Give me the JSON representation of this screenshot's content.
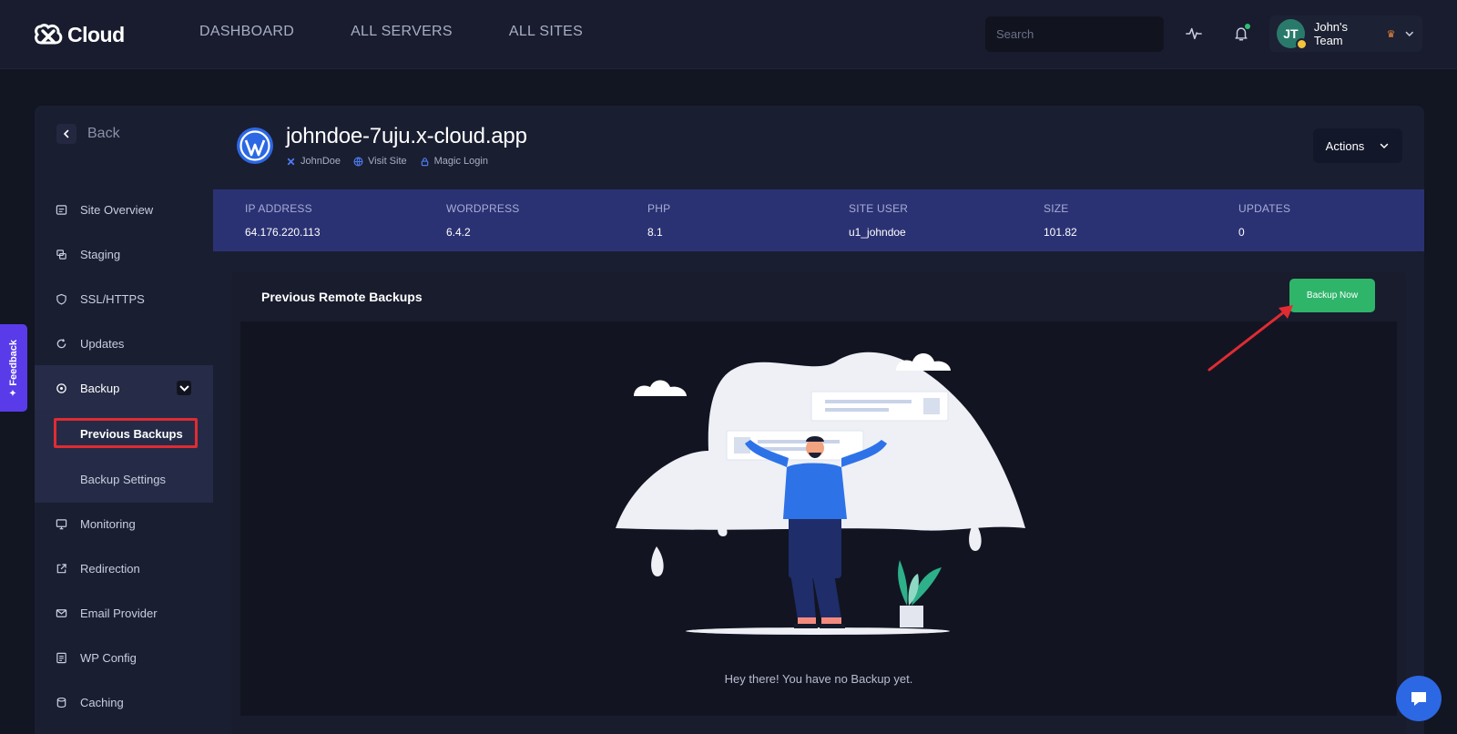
{
  "brand": {
    "name": "Cloud"
  },
  "nav": [
    "DASHBOARD",
    "ALL SERVERS",
    "ALL SITES"
  ],
  "search": {
    "placeholder": "Search"
  },
  "user": {
    "initials": "JT",
    "team": "John's Team"
  },
  "sidebar": {
    "back": "Back",
    "items": [
      {
        "label": "Site Overview",
        "icon": "overview-icon"
      },
      {
        "label": "Staging",
        "icon": "staging-icon"
      },
      {
        "label": "SSL/HTTPS",
        "icon": "shield-icon"
      },
      {
        "label": "Updates",
        "icon": "refresh-icon"
      },
      {
        "label": "Backup",
        "icon": "backup-icon"
      },
      {
        "label": "Monitoring",
        "icon": "monitor-icon"
      },
      {
        "label": "Redirection",
        "icon": "external-link-icon"
      },
      {
        "label": "Email Provider",
        "icon": "mail-icon"
      },
      {
        "label": "WP Config",
        "icon": "config-icon"
      },
      {
        "label": "Caching",
        "icon": "cache-icon"
      }
    ],
    "backup_submenu": [
      "Previous Backups",
      "Backup Settings"
    ]
  },
  "site": {
    "domain": "johndoe-7uju.x-cloud.app",
    "owner": "JohnDoe",
    "visit": "Visit Site",
    "magic_login": "Magic Login",
    "actions_label": "Actions"
  },
  "stats": [
    {
      "key": "IP ADDRESS",
      "value": "64.176.220.113"
    },
    {
      "key": "WORDPRESS",
      "value": "6.4.2"
    },
    {
      "key": "PHP",
      "value": "8.1"
    },
    {
      "key": "SITE USER",
      "value": "u1_johndoe"
    },
    {
      "key": "SIZE",
      "value": "101.82"
    },
    {
      "key": "UPDATES",
      "value": "0"
    }
  ],
  "backups": {
    "title": "Previous Remote Backups",
    "button": "Backup Now",
    "empty": "Hey there! You have no Backup yet."
  },
  "feedback": "Feedback",
  "colors": {
    "accent": "#2fb56a",
    "stats_bar": "#2b3273",
    "highlight": "#e02b33",
    "feedback": "#5a3bea"
  }
}
